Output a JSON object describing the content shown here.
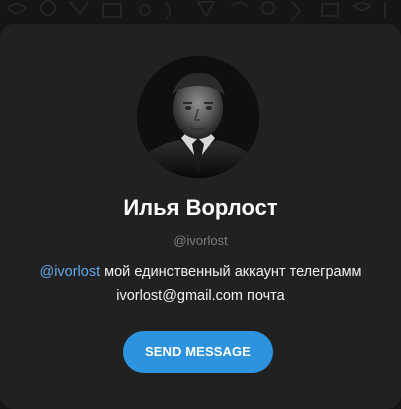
{
  "profile": {
    "avatar_icon": "profile-photo",
    "name": "Илья Ворлост",
    "username": "@ivorlost",
    "bio": {
      "line1_link": "@ivorlost",
      "line1_text": " мой единственный аккаунт телеграмм",
      "line2_text": "ivorlost@gmail.com почта"
    },
    "send_button": "SEND MESSAGE"
  },
  "colors": {
    "background": "#151515",
    "card": "#212121",
    "accent": "#2e93de",
    "link": "#63a9ee",
    "muted": "#7d7d7d",
    "text": "#ffffff"
  }
}
